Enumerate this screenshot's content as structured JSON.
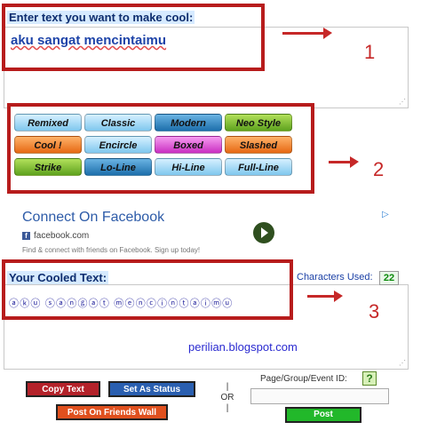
{
  "input": {
    "label": "Enter text you want to make cool:",
    "value": "aku sangat mencintaimu"
  },
  "annotations": {
    "n1": "1",
    "n2": "2",
    "n3": "3"
  },
  "styles": [
    {
      "label": "Remixed",
      "color": "blue"
    },
    {
      "label": "Classic",
      "color": "blue"
    },
    {
      "label": "Modern",
      "color": "dblue"
    },
    {
      "label": "Neo Style",
      "color": "green"
    },
    {
      "label": "Cool !",
      "color": "orange"
    },
    {
      "label": "Encircle",
      "color": "blue"
    },
    {
      "label": "Boxed",
      "color": "magenta"
    },
    {
      "label": "Slashed",
      "color": "orange"
    },
    {
      "label": "Strike",
      "color": "green"
    },
    {
      "label": "Lo-Line",
      "color": "dblue"
    },
    {
      "label": "Hi-Line",
      "color": "blue"
    },
    {
      "label": "Full-Line",
      "color": "blue"
    }
  ],
  "ad": {
    "title": "Connect On Facebook",
    "domain": "facebook.com",
    "description": "Find & connect with friends on Facebook. Sign up today!",
    "fb_letter": "f",
    "choices_glyph": "▷"
  },
  "output": {
    "label": "Your Cooled Text:",
    "value": "ⓐⓚⓤ ⓢⓐⓝⓖⓐⓣ ⓜⓔⓝⓒⓘⓝⓣⓐⓘⓜⓤ",
    "chars_label": "Characters Used:",
    "chars_count": "22",
    "watermark": "perilian.blogspot.com"
  },
  "actions": {
    "copy": "Copy Text",
    "status": "Set As Status",
    "wall": "Post On Friends Wall",
    "or_top": "|",
    "or_text": "OR",
    "or_bottom": "|",
    "page_id_label": "Page/Group/Event ID:",
    "help": "?",
    "post": "Post"
  },
  "colors": {
    "frame": "#b71c1c",
    "arrow": "#c62828",
    "link": "#2d5ba8"
  }
}
